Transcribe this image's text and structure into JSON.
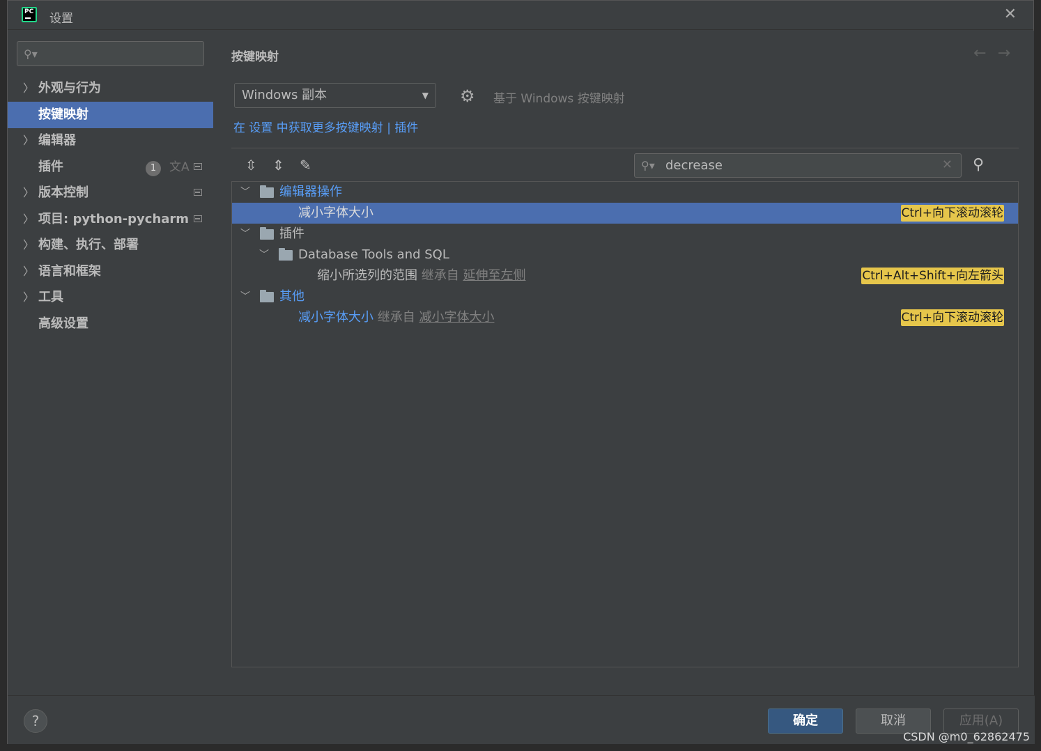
{
  "window": {
    "title": "设置",
    "logo_text": "PC"
  },
  "sidebar": {
    "search_placeholder": "",
    "items": [
      {
        "label": "外观与行为",
        "expandable": true
      },
      {
        "label": "按键映射",
        "expandable": false,
        "selected": true
      },
      {
        "label": "编辑器",
        "expandable": true
      },
      {
        "label": "插件",
        "expandable": false,
        "badge": "1"
      },
      {
        "label": "版本控制",
        "expandable": true
      },
      {
        "label": "项目: python-pycharm",
        "expandable": true
      },
      {
        "label": "构建、执行、部署",
        "expandable": true
      },
      {
        "label": "语言和框架",
        "expandable": true
      },
      {
        "label": "工具",
        "expandable": true
      },
      {
        "label": "高级设置",
        "expandable": false
      }
    ]
  },
  "main": {
    "title": "按键映射",
    "keymap_select": "Windows 副本",
    "based_on": "基于 Windows 按键映射",
    "more_link": "在 设置 中获取更多按键映射 | 插件",
    "filter_value": "decrease",
    "tree": [
      {
        "type": "group",
        "label": "编辑器操作",
        "highlight": true
      },
      {
        "type": "action",
        "label": "减小字体大小",
        "shortcut": "Ctrl+向下滚动滚轮",
        "selected": true
      },
      {
        "type": "group",
        "label": "插件"
      },
      {
        "type": "subgroup",
        "label": "Database Tools and SQL"
      },
      {
        "type": "action",
        "label": "缩小所选列的范围",
        "inherit_prefix": "继承自",
        "inherit_from": "延伸至左侧",
        "shortcut": "Ctrl+Alt+Shift+向左箭头"
      },
      {
        "type": "group",
        "label": "其他",
        "highlight": true
      },
      {
        "type": "action",
        "label": "减小字体大小",
        "inherit_prefix": "继承自",
        "inherit_from": "减小字体大小",
        "shortcut": "Ctrl+向下滚动滚轮"
      }
    ]
  },
  "footer": {
    "help": "?",
    "ok": "确定",
    "cancel": "取消",
    "apply": "应用(A)"
  },
  "watermark": "CSDN @m0_62862475",
  "colors": {
    "accent": "#4b6eaf",
    "link": "#589df6",
    "shortcut_bg": "#e6c64b"
  }
}
